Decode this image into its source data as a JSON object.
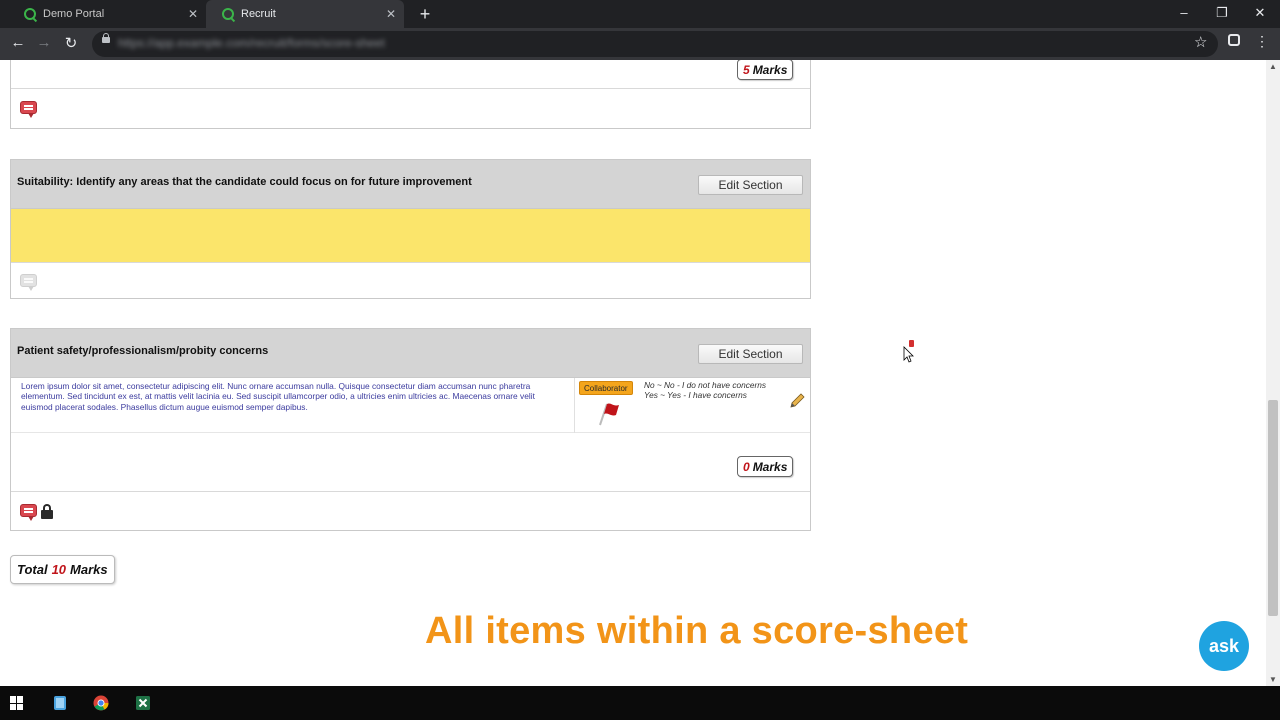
{
  "browser": {
    "tabs": [
      {
        "title": "Demo Portal",
        "active": false
      },
      {
        "title": "Recruit",
        "active": true
      }
    ],
    "new_tab": "+",
    "window_controls": {
      "minimize": "–",
      "restore": "❐",
      "close": "✕"
    },
    "nav": {
      "back": "←",
      "forward": "→",
      "reload": "↻"
    },
    "url": "https://app.example.com/recruit/forms/score-sheet",
    "bookmark_icon": "☆",
    "menu_icon": "⋮"
  },
  "sections": [
    {
      "marks_value": "5",
      "marks_label": "Marks"
    },
    {
      "title": "Suitability: Identify any areas that the candidate could focus on for future improvement",
      "edit_label": "Edit Section"
    },
    {
      "title": "Patient safety/professionalism/probity concerns",
      "edit_label": "Edit Section",
      "description": "Lorem ipsum dolor sit amet, consectetur adipiscing elit. Nunc ornare accumsan nulla. Quisque consectetur diam accumsan nunc pharetra elementum. Sed tincidunt ex est, at mattis velit lacinia eu. Sed suscipit ullamcorper odio, a ultricies enim ultricies ac. Maecenas ornare velit euismod placerat sodales. Phasellus dictum augue euismod semper dapibus.",
      "role": "Collaborator",
      "answer_no": "No ~ No - I do not have concerns",
      "answer_yes": "Yes ~ Yes - I have concerns",
      "marks_value": "0",
      "marks_label": "Marks"
    }
  ],
  "total": {
    "label": "Total",
    "value": "10",
    "unit": "Marks"
  },
  "caption": "All items within a score-sheet",
  "ask_button": "ask",
  "colors": {
    "accent_orange": "#f29418",
    "marks_red": "#c0141a",
    "highlight_yellow": "#fbe56b",
    "ask_blue": "#1fa3e0",
    "role_badge": "#f4a51c"
  }
}
